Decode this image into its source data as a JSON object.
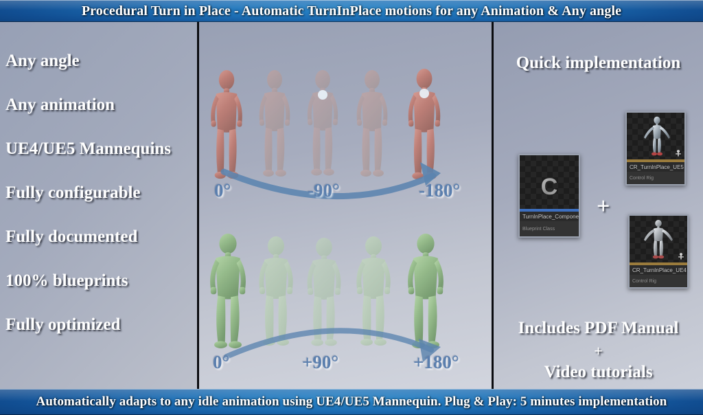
{
  "banner_top": {
    "text": "Procedural Turn in Place - Automatic TurnInPlace motions for any Animation & Any angle"
  },
  "banner_bottom": {
    "text": "Automatically adapts to any idle animation using UE4/UE5 Mannequin. Plug & Play: 5 minutes implementation"
  },
  "left_column": {
    "features": [
      "Any angle",
      "Any animation",
      "UE4/UE5 Mannequins",
      "Fully configurable",
      "Fully documented",
      "100% blueprints",
      "Fully optimized"
    ]
  },
  "center_column": {
    "top_sequence": {
      "character_color": "#c98d84",
      "angles": [
        "0°",
        "-90°",
        "-180°"
      ],
      "arrow_direction": "clockwise-right",
      "arrow_color": "#5b84af"
    },
    "bottom_sequence": {
      "character_color": "#9cc191",
      "angles": [
        "0°",
        "+90°",
        "+180°"
      ],
      "arrow_direction": "counterclockwise-right",
      "arrow_color": "#5b84af"
    }
  },
  "right_column": {
    "heading_quick": "Quick implementation",
    "plus_symbol": "+",
    "assets": [
      {
        "name": "TurnInPlace_Component",
        "type": "Blueprint Class",
        "icon": "blueprint-c-icon",
        "strip_color": "#3d6fbf"
      },
      {
        "name": "CR_TurnInPlace_UE5",
        "type": "Control Rig",
        "icon": "control-rig-icon",
        "strip_color": "#9a7b3c"
      },
      {
        "name": "CR_TurnInPlace_UE4",
        "type": "Control Rig",
        "icon": "control-rig-icon",
        "strip_color": "#9a7b3c"
      }
    ],
    "heading_pdf": "Includes PDF Manual",
    "heading_plus": "+",
    "heading_video": "Video tutorials"
  },
  "theme": {
    "banner_blue": "#1d6fb5",
    "background_gray": "#a6acbe",
    "angle_label_color": "#5b7fae",
    "text_white": "#ffffff"
  }
}
